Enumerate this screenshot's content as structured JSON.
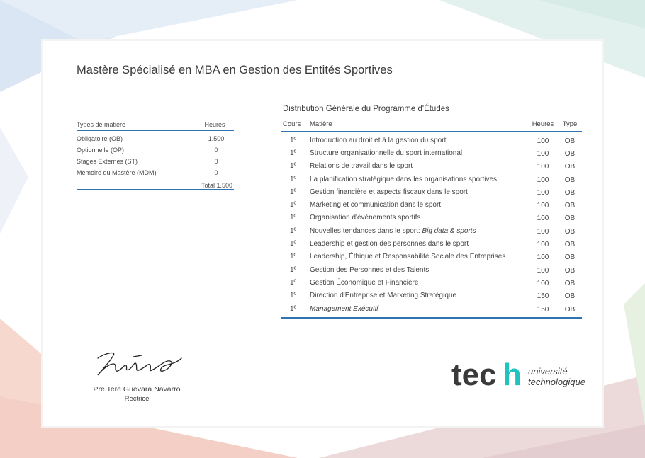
{
  "colors": {
    "accent": "#2f73b3",
    "logo_dark": "#3a3a3a",
    "logo_h": "#21c3c0",
    "text": "#3b3b3b"
  },
  "document": {
    "title": "Mastère Spécialisé en MBA en Gestion des Entités Sportives"
  },
  "summary_table": {
    "header": {
      "type": "Types de matière",
      "hours": "Heures"
    },
    "rows": [
      {
        "label": "Obligatoire (OB)",
        "hours": "1.500"
      },
      {
        "label": "Optionnelle (OP)",
        "hours": "0"
      },
      {
        "label": "Stages Externes (ST)",
        "hours": "0"
      },
      {
        "label": "Mémoire du Mastère (MDM)",
        "hours": "0"
      }
    ],
    "total": "Total 1.500"
  },
  "distribution": {
    "title": "Distribution Générale du Programme d'Études",
    "header": {
      "course": "Cours",
      "subject": "Matière",
      "hours": "Heures",
      "type": "Type"
    },
    "rows": [
      {
        "course": "1º",
        "subject": "Introduction au droit et à la gestion du sport",
        "hours": "100",
        "type": "OB"
      },
      {
        "course": "1º",
        "subject": "Structure organisationnelle du sport international",
        "hours": "100",
        "type": "OB"
      },
      {
        "course": "1º",
        "subject": "Relations de travail dans le sport",
        "hours": "100",
        "type": "OB"
      },
      {
        "course": "1º",
        "subject": "La planification stratégique dans les organisations sportives",
        "hours": "100",
        "type": "OB"
      },
      {
        "course": "1º",
        "subject": "Gestion financière et aspects fiscaux dans le sport",
        "hours": "100",
        "type": "OB"
      },
      {
        "course": "1º",
        "subject": "Marketing et communication dans le sport",
        "hours": "100",
        "type": "OB"
      },
      {
        "course": "1º",
        "subject": "Organisation d'événements sportifs",
        "hours": "100",
        "type": "OB"
      },
      {
        "course": "1º",
        "subject": "Nouvelles tendances dans le sport: ",
        "subject_italic": "Big data & sports",
        "hours": "100",
        "type": "OB"
      },
      {
        "course": "1º",
        "subject": "Leadership et gestion des personnes dans le sport",
        "hours": "100",
        "type": "OB"
      },
      {
        "course": "1º",
        "subject": "Leadership, Éthique et Responsabilité Sociale des Entreprises",
        "hours": "100",
        "type": "OB"
      },
      {
        "course": "1º",
        "subject": "Gestion des Personnes et des Talents",
        "hours": "100",
        "type": "OB"
      },
      {
        "course": "1º",
        "subject": "Gestion Économique et Financière",
        "hours": "100",
        "type": "OB"
      },
      {
        "course": "1º",
        "subject": "Direction d'Entreprise et Marketing Stratégique",
        "hours": "150",
        "type": "OB"
      },
      {
        "course": "1º",
        "subject": "",
        "subject_italic": "Management Exécutif",
        "hours": "150",
        "type": "OB"
      }
    ]
  },
  "signatory": {
    "name": "Pre Tere Guevara Navarro",
    "role": "Rectrice"
  },
  "logo": {
    "wordmark": "tech",
    "line1": "université",
    "line2": "technologique"
  }
}
